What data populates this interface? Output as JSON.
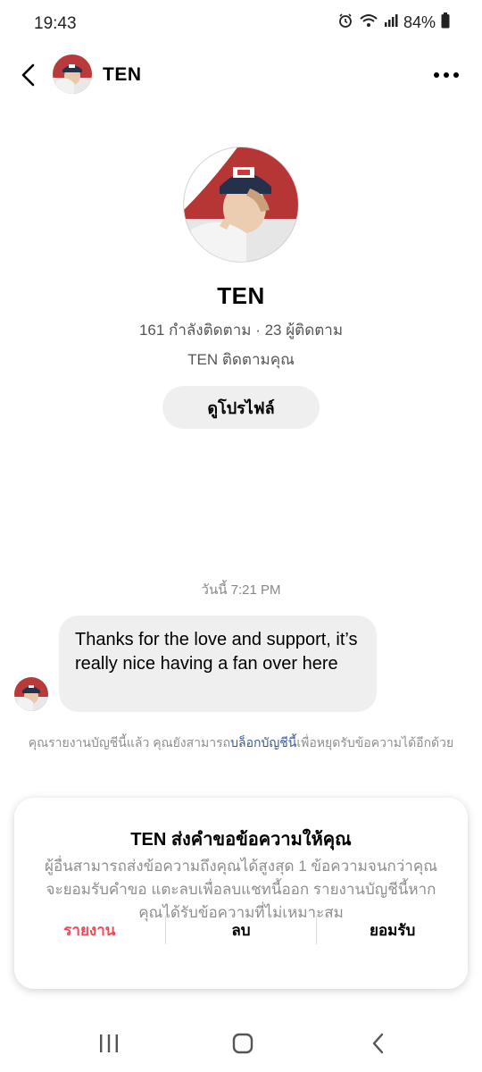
{
  "status_bar": {
    "time": "19:43",
    "battery": "84%",
    "icons": [
      "alarm-icon",
      "wifi-icon",
      "signal-icon",
      "battery-icon"
    ]
  },
  "header": {
    "name": "TEN",
    "icons": {
      "back": "back-arrow-icon",
      "more": "more-dots-icon"
    }
  },
  "profile": {
    "name": "TEN",
    "stats": "161 กำลังติดตาม · 23 ผู้ติดตาม",
    "follow_status": "TEN ติดตามคุณ",
    "view_profile_label": "ดูโปรไฟล์"
  },
  "conversation": {
    "timestamp": "วันนี้ 7:21 PM",
    "message": "Thanks for the love and support, it’s really nice having a fan over here"
  },
  "notice": {
    "before": "คุณรายงานบัญชีนี้แล้ว คุณยังสามารถ",
    "link": "บล็อกบัญชีนี้",
    "after": "เพื่อหยุดรับข้อความได้อีกด้วย"
  },
  "request": {
    "title": "TEN ส่งคำขอข้อความให้คุณ",
    "body": "ผู้อื่นสามารถส่งข้อความถึงคุณได้สูงสุด 1 ข้อความจนกว่าคุณจะยอมรับคำขอ แตะลบเพื่อลบแชทนี้ออก รายงานบัญชีนี้หากคุณได้รับข้อความที่ไม่เหมาะสม",
    "report_label": "รายงาน",
    "delete_label": "ลบ",
    "accept_label": "ยอมรับ"
  },
  "colors": {
    "report": "#ed4956",
    "link": "#385898",
    "bubble": "#efefef"
  },
  "nav_bar": {
    "icons": [
      "recent-apps-icon",
      "home-icon",
      "back-nav-icon"
    ]
  }
}
